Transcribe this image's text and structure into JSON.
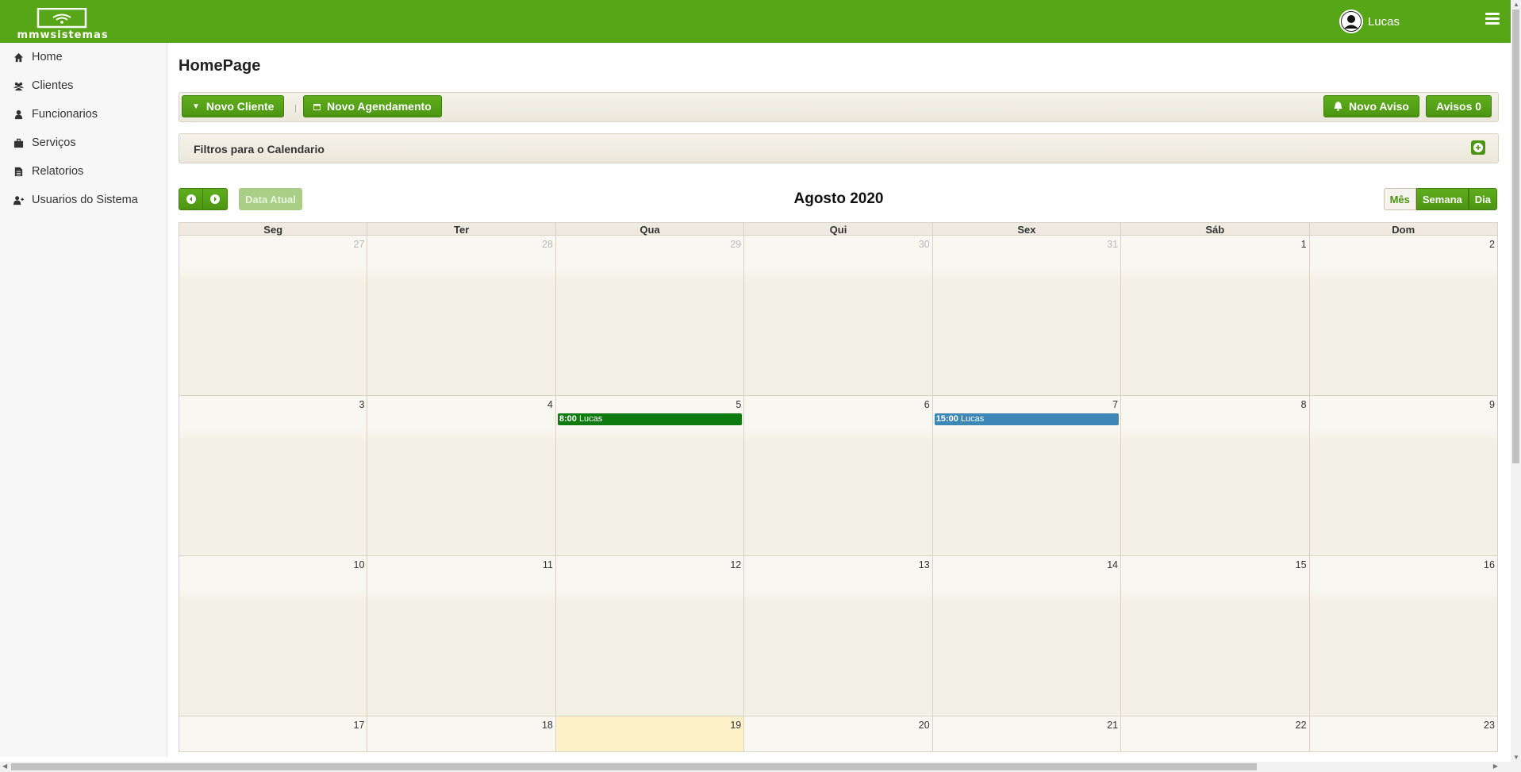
{
  "app": {
    "logo_text": "mmwsistemas",
    "user_name": "Lucas"
  },
  "sidebar": {
    "items": [
      {
        "label": "Home",
        "icon": "home-icon"
      },
      {
        "label": "Clientes",
        "icon": "users-icon"
      },
      {
        "label": "Funcionarios",
        "icon": "user-icon"
      },
      {
        "label": "Serviços",
        "icon": "briefcase-icon"
      },
      {
        "label": "Relatorios",
        "icon": "file-icon"
      },
      {
        "label": "Usuarios do Sistema",
        "icon": "user-plus-icon"
      }
    ]
  },
  "page": {
    "title": "HomePage"
  },
  "toolbar": {
    "novo_cliente": "Novo Cliente",
    "novo_agendamento": "Novo Agendamento",
    "novo_aviso": "Novo Aviso",
    "avisos": "Avisos 0"
  },
  "filters": {
    "label": "Filtros para o Calendario"
  },
  "calendar": {
    "title": "Agosto 2020",
    "today_button": "Data Atual",
    "views": {
      "month": "Mês",
      "week": "Semana",
      "day": "Dia"
    },
    "weekdays": [
      "Seg",
      "Ter",
      "Qua",
      "Qui",
      "Sex",
      "Sáb",
      "Dom"
    ],
    "weeks": [
      [
        {
          "day": "27",
          "other": true
        },
        {
          "day": "28",
          "other": true
        },
        {
          "day": "29",
          "other": true
        },
        {
          "day": "30",
          "other": true
        },
        {
          "day": "31",
          "other": true
        },
        {
          "day": "1"
        },
        {
          "day": "2"
        }
      ],
      [
        {
          "day": "3"
        },
        {
          "day": "4"
        },
        {
          "day": "5",
          "event": {
            "time": "8:00",
            "title": "Lucas",
            "color": "#0f7a0f"
          }
        },
        {
          "day": "6"
        },
        {
          "day": "7",
          "event": {
            "time": "15:00",
            "title": "Lucas",
            "color": "#3c87b5"
          }
        },
        {
          "day": "8"
        },
        {
          "day": "9"
        }
      ],
      [
        {
          "day": "10"
        },
        {
          "day": "11"
        },
        {
          "day": "12"
        },
        {
          "day": "13"
        },
        {
          "day": "14"
        },
        {
          "day": "15"
        },
        {
          "day": "16"
        }
      ],
      [
        {
          "day": "17"
        },
        {
          "day": "18"
        },
        {
          "day": "19",
          "today": true
        },
        {
          "day": "20"
        },
        {
          "day": "21"
        },
        {
          "day": "22"
        },
        {
          "day": "23"
        }
      ]
    ]
  },
  "colors": {
    "brand": "#57a617",
    "button": "#4c9512",
    "today": "#fcf1c8",
    "event_green": "#0f7a0f",
    "event_blue": "#3c87b5"
  }
}
